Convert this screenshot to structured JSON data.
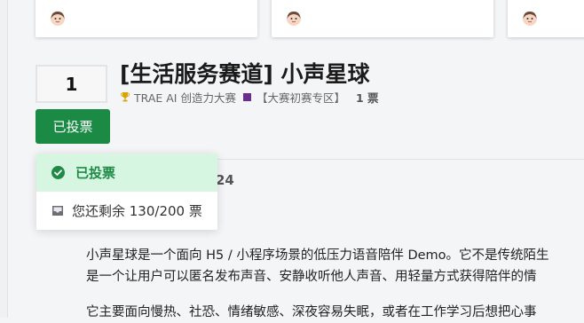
{
  "cards": [
    {
      "avatar_icon": "user-avatar-icon"
    },
    {
      "avatar_icon": "user-avatar-icon"
    },
    {
      "avatar_icon": "user-avatar-icon"
    }
  ],
  "vote": {
    "count": "1",
    "button_label": "已投票"
  },
  "topic": {
    "title": "[生活服务赛道] 小声星球",
    "trophy_icon": "trophy-icon",
    "event_name": "TRAE AI 创造力大赛",
    "category_color": "#6b2d90",
    "category": "【大赛初赛专区】",
    "votes": "1 票"
  },
  "behind_menu_number": "24",
  "vote_menu": {
    "voted_label": "已投票",
    "remaining_label": "您还剩余 130/200 票"
  },
  "post": {
    "line1": "小声星球是一个面向 H5 / 小程序场景的低压力语音陪伴 Demo。它不是传统陌生",
    "line2": "是一个让用户可以匿名发布声音、安静收听他人声音、用轻量方式获得陪伴的情",
    "line3": "它主要面向慢热、社恐、情绪敏感、深夜容易失眠，或者在工作学习后想把心事"
  },
  "colors": {
    "accent_green": "#1b8a44",
    "voted_bg": "#d7f6e2",
    "category_purple": "#6b2d90"
  }
}
